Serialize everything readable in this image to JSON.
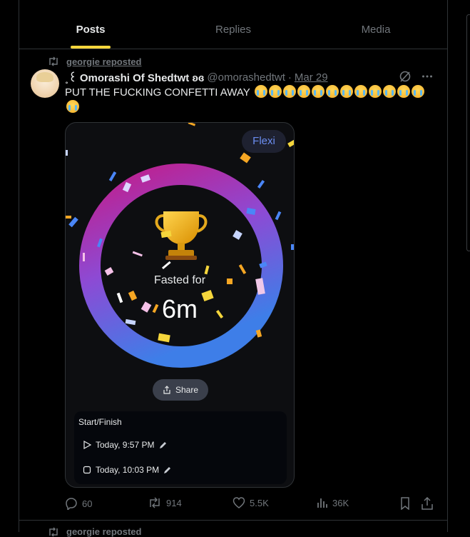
{
  "tabs": [
    {
      "label": "Posts"
    },
    {
      "label": "Replies"
    },
    {
      "label": "Media"
    }
  ],
  "accent": "#f5d63c",
  "post": {
    "repost_label": "georgie reposted",
    "author_name": "˳꒰ Omorashi Of Shedtwt ʚɞ",
    "handle": "@omorashedtwt",
    "separator": "·",
    "date": "Mar 29",
    "text": "PUT THE FUCKING CONFETTI AWAY",
    "emoji_count": 13,
    "emoji_name": "loudly-crying-face",
    "media": {
      "flexi_label": "Flexi",
      "fasted_label": "Fasted for",
      "duration": "6m",
      "share_label": "Share",
      "start_finish_title": "Start/Finish",
      "start_time": "Today, 9:57 PM",
      "end_time": "Today, 10:03 PM"
    },
    "stats": {
      "replies": "60",
      "reposts": "914",
      "likes": "5.5K",
      "views": "36K"
    }
  },
  "next_post": {
    "repost_label": "georgie reposted"
  }
}
